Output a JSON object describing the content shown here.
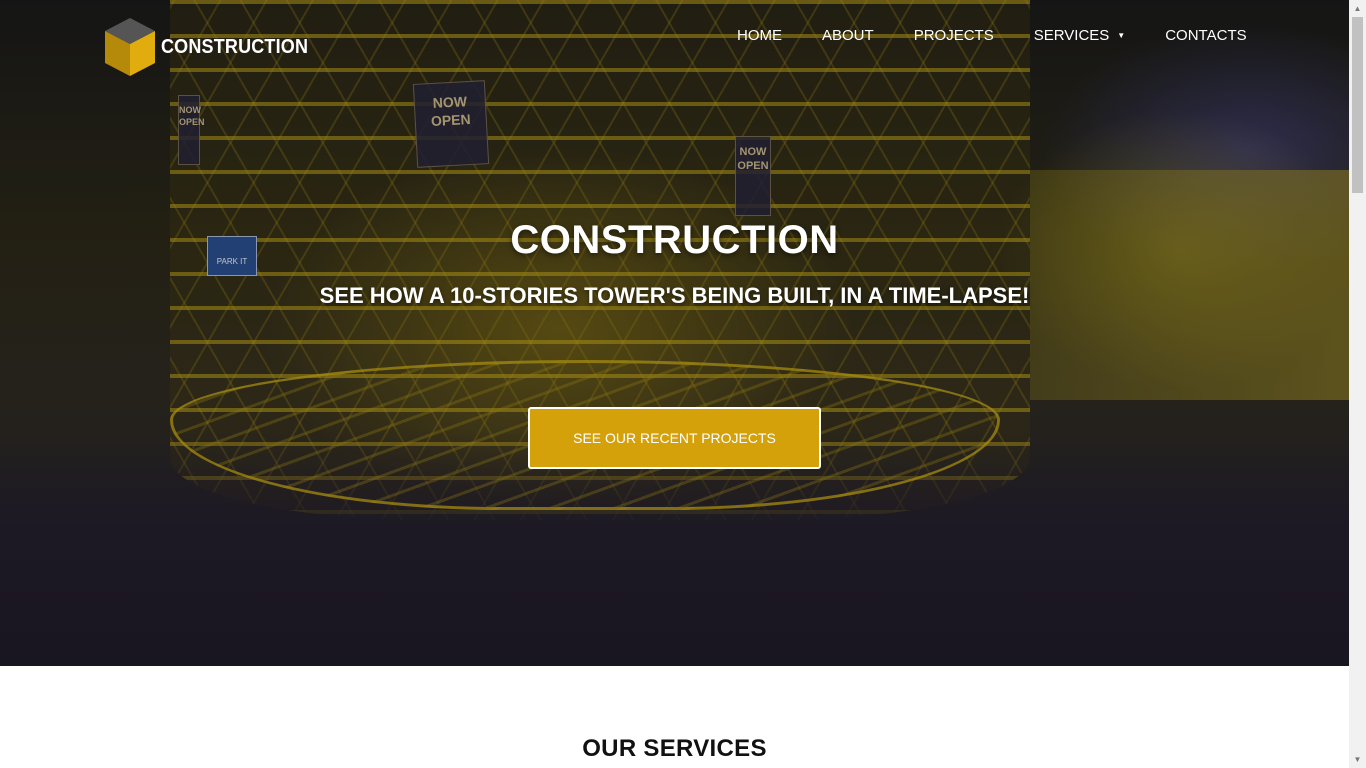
{
  "brand": {
    "name": "CONSTRUCTION",
    "accent": "#d4a10a"
  },
  "nav": {
    "items": [
      {
        "label": "HOME"
      },
      {
        "label": "ABOUT"
      },
      {
        "label": "PROJECTS"
      },
      {
        "label": "SERVICES",
        "has_dropdown": true
      },
      {
        "label": "CONTACTS"
      }
    ],
    "dropdown_caret": "▼"
  },
  "hero": {
    "title": "CONSTRUCTION",
    "subtitle": "SEE HOW A 10-STORIES TOWER'S BEING BUILT, IN A TIME-LAPSE!",
    "cta_label": "SEE OUR RECENT PROJECTS",
    "signs": [
      "NOW OPEN",
      "NOW OPEN",
      "NOW OPEN"
    ],
    "street_sign": "PARK IT"
  },
  "services": {
    "title": "OUR SERVICES"
  },
  "scrollbar": {
    "up_arrow": "▲",
    "down_arrow": "▼"
  }
}
